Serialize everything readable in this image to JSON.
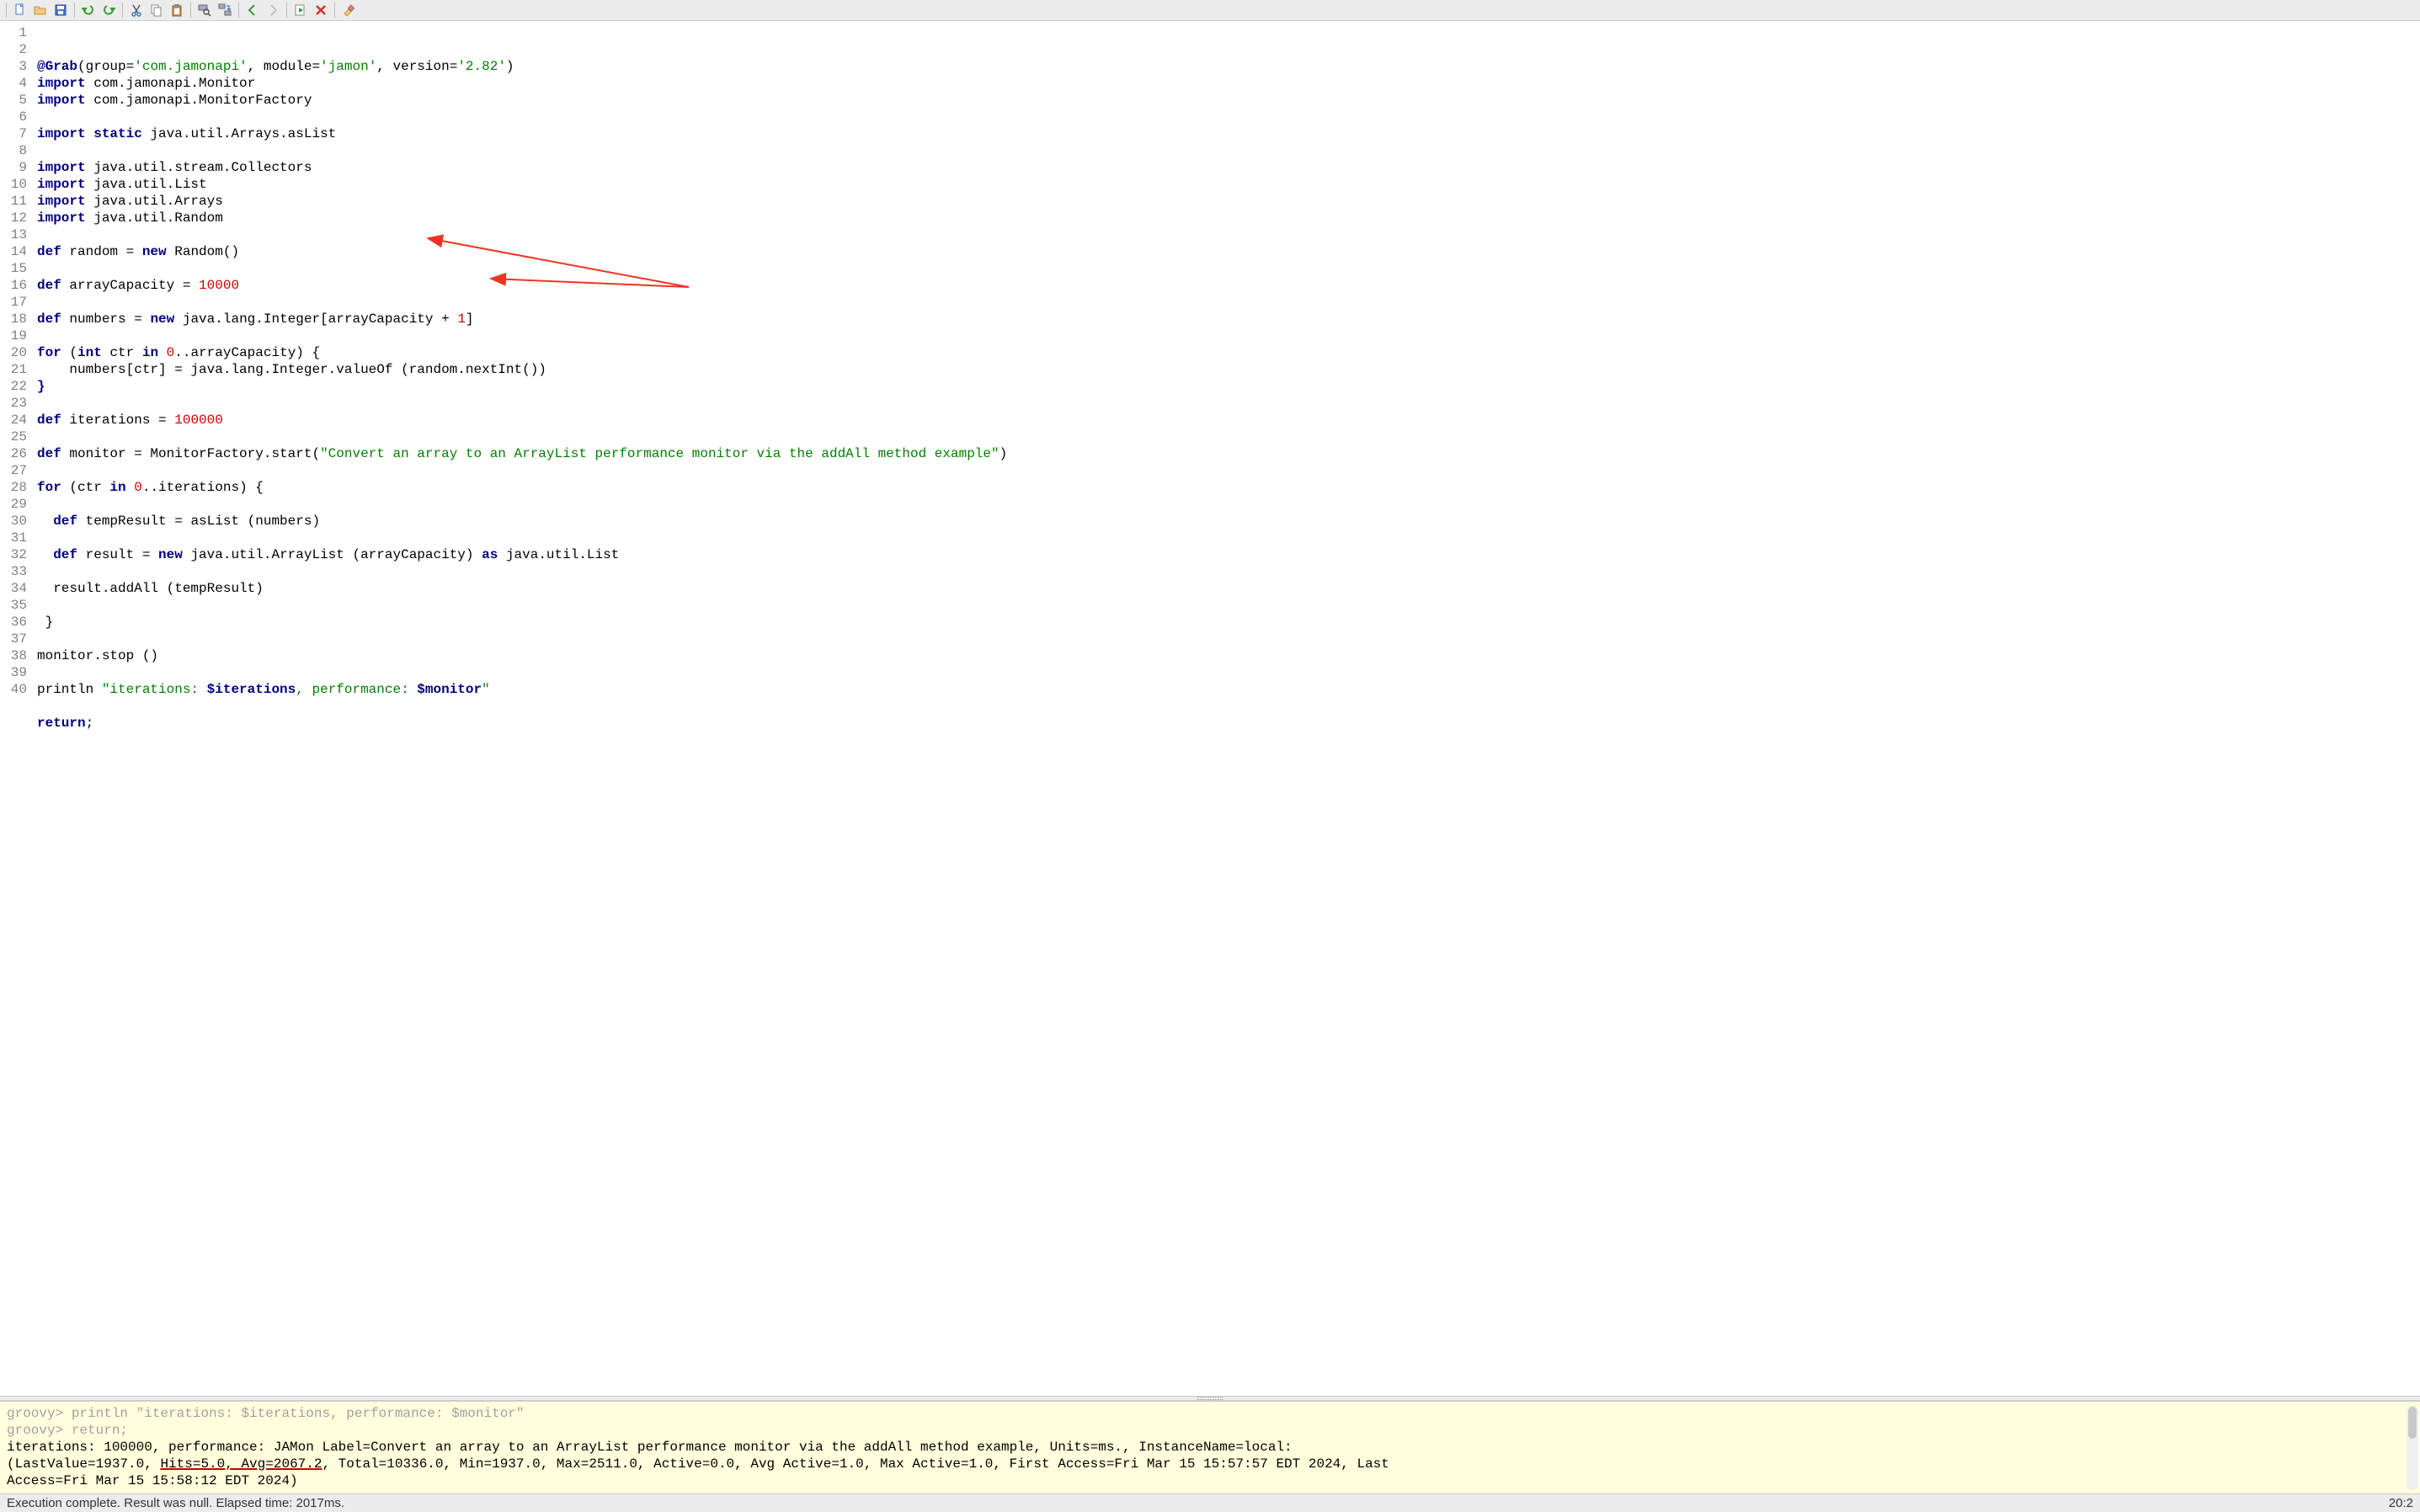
{
  "toolbar": {
    "icons": [
      "new-file-icon",
      "open-file-icon",
      "save-icon",
      "undo-icon",
      "redo-icon",
      "cut-icon",
      "copy-icon",
      "paste-icon",
      "find-icon",
      "replace-icon",
      "history-back-icon",
      "history-forward-icon",
      "run-icon",
      "stop-icon",
      "clear-icon"
    ]
  },
  "code": {
    "lines": [
      {
        "n": 1,
        "tokens": [
          {
            "t": "@Grab",
            "c": "kw"
          },
          {
            "t": "(group="
          },
          {
            "t": "'com.jamonapi'",
            "c": "str"
          },
          {
            "t": ", module="
          },
          {
            "t": "'jamon'",
            "c": "str"
          },
          {
            "t": ", version="
          },
          {
            "t": "'2.82'",
            "c": "str"
          },
          {
            "t": ")"
          }
        ]
      },
      {
        "n": 2,
        "tokens": [
          {
            "t": "import",
            "c": "kw"
          },
          {
            "t": " com.jamonapi.Monitor"
          }
        ]
      },
      {
        "n": 3,
        "tokens": [
          {
            "t": "import",
            "c": "kw"
          },
          {
            "t": " com.jamonapi.MonitorFactory"
          }
        ]
      },
      {
        "n": 4,
        "tokens": []
      },
      {
        "n": 5,
        "tokens": [
          {
            "t": "import",
            "c": "kw"
          },
          {
            "t": " "
          },
          {
            "t": "static",
            "c": "kw"
          },
          {
            "t": " java.util.Arrays.asList"
          }
        ]
      },
      {
        "n": 6,
        "tokens": []
      },
      {
        "n": 7,
        "tokens": [
          {
            "t": "import",
            "c": "kw"
          },
          {
            "t": " java.util.stream.Collectors"
          }
        ]
      },
      {
        "n": 8,
        "tokens": [
          {
            "t": "import",
            "c": "kw"
          },
          {
            "t": " java.util.List"
          }
        ]
      },
      {
        "n": 9,
        "tokens": [
          {
            "t": "import",
            "c": "kw"
          },
          {
            "t": " java.util.Arrays"
          }
        ]
      },
      {
        "n": 10,
        "tokens": [
          {
            "t": "import",
            "c": "kw"
          },
          {
            "t": " java.util.Random"
          }
        ]
      },
      {
        "n": 11,
        "tokens": []
      },
      {
        "n": 12,
        "tokens": [
          {
            "t": "def",
            "c": "kw"
          },
          {
            "t": " random = "
          },
          {
            "t": "new",
            "c": "kw"
          },
          {
            "t": " Random()"
          }
        ]
      },
      {
        "n": 13,
        "tokens": []
      },
      {
        "n": 14,
        "tokens": [
          {
            "t": "def",
            "c": "kw"
          },
          {
            "t": " arrayCapacity = "
          },
          {
            "t": "10000",
            "c": "num"
          }
        ]
      },
      {
        "n": 15,
        "tokens": []
      },
      {
        "n": 16,
        "tokens": [
          {
            "t": "def",
            "c": "kw"
          },
          {
            "t": " numbers = "
          },
          {
            "t": "new",
            "c": "kw"
          },
          {
            "t": " java.lang.Integer[arrayCapacity + "
          },
          {
            "t": "1",
            "c": "num"
          },
          {
            "t": "]"
          }
        ]
      },
      {
        "n": 17,
        "tokens": []
      },
      {
        "n": 18,
        "tokens": [
          {
            "t": "for",
            "c": "kw"
          },
          {
            "t": " ("
          },
          {
            "t": "int",
            "c": "kw"
          },
          {
            "t": " ctr "
          },
          {
            "t": "in",
            "c": "kw"
          },
          {
            "t": " "
          },
          {
            "t": "0",
            "c": "num"
          },
          {
            "t": "..arrayCapacity) {"
          }
        ]
      },
      {
        "n": 19,
        "tokens": [
          {
            "t": "    numbers[ctr] = java.lang.Integer.valueOf (random.nextInt())"
          }
        ]
      },
      {
        "n": 20,
        "tokens": [
          {
            "t": "}",
            "c": "kw"
          }
        ]
      },
      {
        "n": 21,
        "tokens": []
      },
      {
        "n": 22,
        "tokens": [
          {
            "t": "def",
            "c": "kw"
          },
          {
            "t": " iterations = "
          },
          {
            "t": "100000",
            "c": "num"
          }
        ]
      },
      {
        "n": 23,
        "tokens": []
      },
      {
        "n": 24,
        "tokens": [
          {
            "t": "def",
            "c": "kw"
          },
          {
            "t": " monitor = MonitorFactory.start("
          },
          {
            "t": "\"Convert an array to an ArrayList performance monitor via the addAll method example\"",
            "c": "str"
          },
          {
            "t": ")"
          }
        ]
      },
      {
        "n": 25,
        "tokens": []
      },
      {
        "n": 26,
        "tokens": [
          {
            "t": "for",
            "c": "kw"
          },
          {
            "t": " (ctr "
          },
          {
            "t": "in",
            "c": "kw"
          },
          {
            "t": " "
          },
          {
            "t": "0",
            "c": "num"
          },
          {
            "t": "..iterations) {"
          }
        ]
      },
      {
        "n": 27,
        "tokens": []
      },
      {
        "n": 28,
        "tokens": [
          {
            "t": "  "
          },
          {
            "t": "def",
            "c": "kw"
          },
          {
            "t": " tempResult = asList (numbers)"
          }
        ]
      },
      {
        "n": 29,
        "tokens": []
      },
      {
        "n": 30,
        "tokens": [
          {
            "t": "  "
          },
          {
            "t": "def",
            "c": "kw"
          },
          {
            "t": " result = "
          },
          {
            "t": "new",
            "c": "kw"
          },
          {
            "t": " java.util.ArrayList (arrayCapacity) "
          },
          {
            "t": "as",
            "c": "kw"
          },
          {
            "t": " java.util.List"
          }
        ]
      },
      {
        "n": 31,
        "tokens": []
      },
      {
        "n": 32,
        "tokens": [
          {
            "t": "  result.addAll (tempResult)"
          }
        ]
      },
      {
        "n": 33,
        "tokens": []
      },
      {
        "n": 34,
        "tokens": [
          {
            "t": " }"
          }
        ]
      },
      {
        "n": 35,
        "tokens": []
      },
      {
        "n": 36,
        "tokens": [
          {
            "t": "monitor.stop ()"
          }
        ]
      },
      {
        "n": 37,
        "tokens": []
      },
      {
        "n": 38,
        "tokens": [
          {
            "t": "println "
          },
          {
            "t": "\"iterations: ",
            "c": "str"
          },
          {
            "t": "$iterations",
            "c": "str-var"
          },
          {
            "t": ", performance: ",
            "c": "str"
          },
          {
            "t": "$monitor",
            "c": "str-var"
          },
          {
            "t": "\"",
            "c": "str"
          }
        ]
      },
      {
        "n": 39,
        "tokens": []
      },
      {
        "n": 40,
        "tokens": [
          {
            "t": "return",
            "c": "kw"
          },
          {
            "t": ";"
          }
        ]
      }
    ]
  },
  "output": {
    "faded1": "groovy> println \"iterations: $iterations, performance: $monitor\"",
    "faded2": "groovy> return;",
    "blank": " ",
    "line1_pre": "iterations: 100000, performance: JAMon Label=Convert an array to an ArrayList performance monitor via the addAll method example, Units=ms., InstanceName=local: ",
    "line2_pre": "(LastValue=1937.0, ",
    "line2_underlined": "Hits=5.0, Avg=2067.2",
    "line2_post": ", Total=10336.0, Min=1937.0, Max=2511.0, Active=0.0, Avg Active=1.0, Max Active=1.0, First Access=Fri Mar 15 15:57:57 EDT 2024, Last ",
    "line3": "Access=Fri Mar 15 15:58:12 EDT 2024)"
  },
  "status": {
    "left": "Execution complete. Result was null. Elapsed time: 2017ms.",
    "right": "20:2"
  }
}
